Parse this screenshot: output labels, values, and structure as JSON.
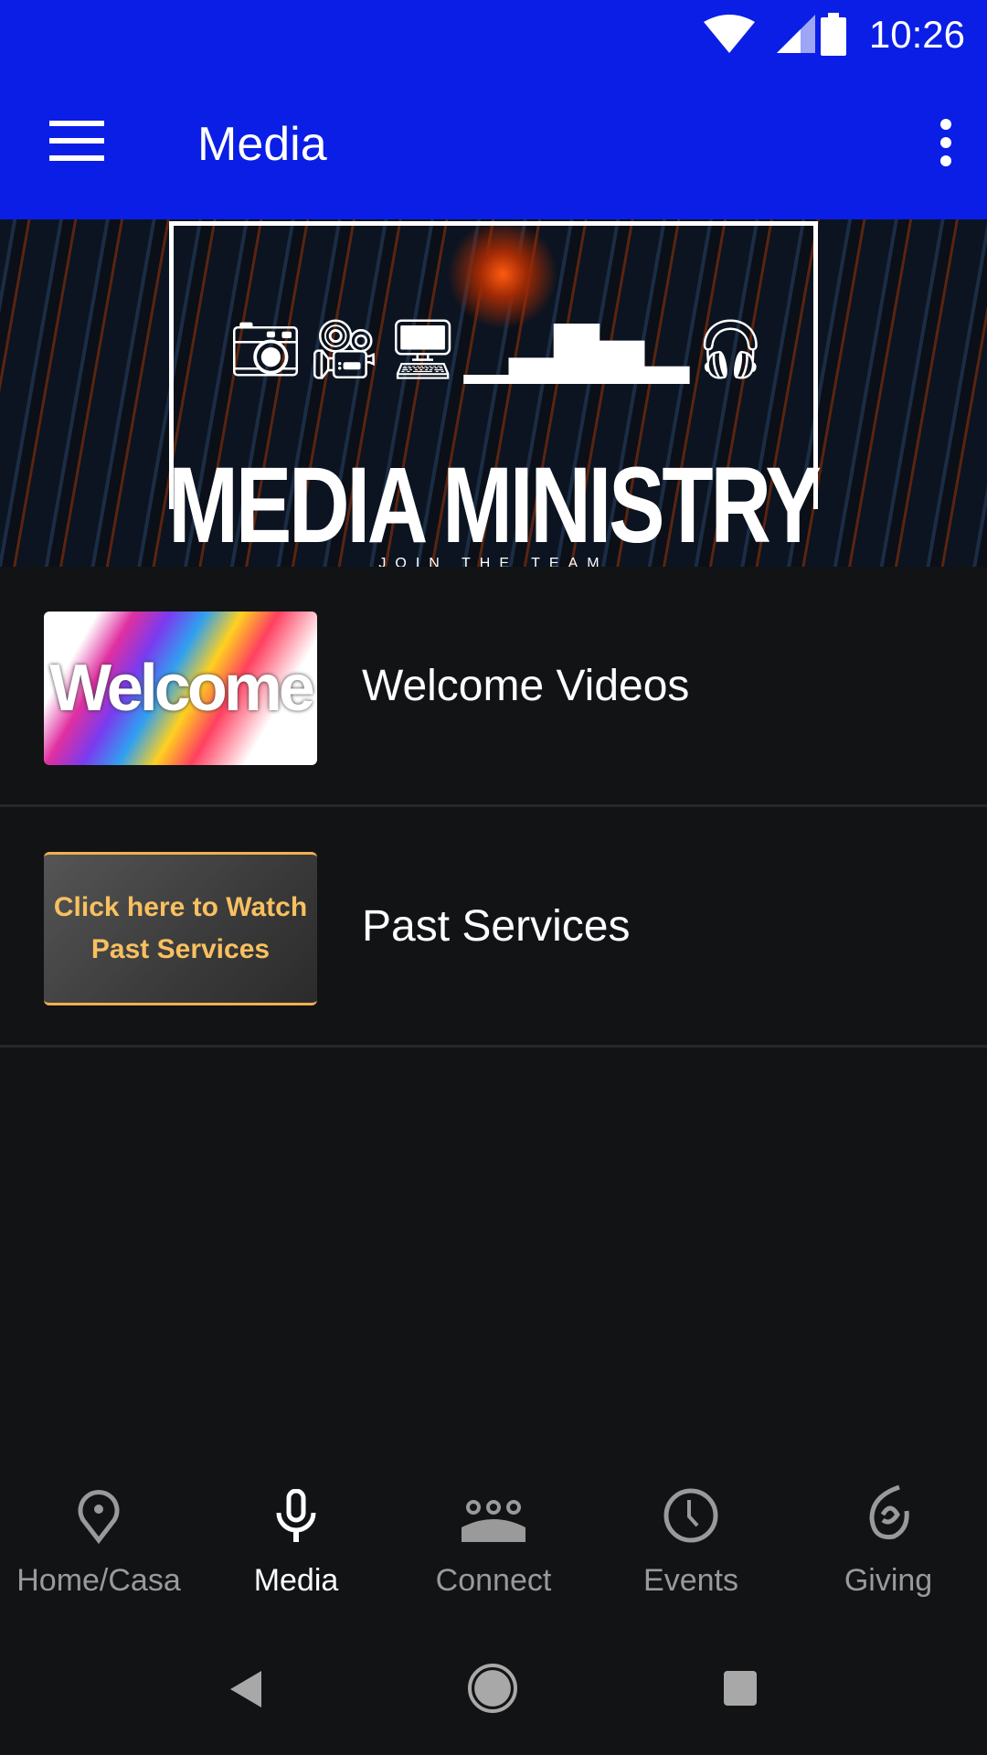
{
  "status_bar": {
    "time": "10:26",
    "icons": [
      "wifi-icon",
      "signal-icon",
      "battery-icon"
    ]
  },
  "app_bar": {
    "title": "Media",
    "menu_icon": "hamburger-icon",
    "more_icon": "more-vert-icon"
  },
  "banner": {
    "headline": "MEDIA MINISTRY",
    "subtext": "JOIN THE TEAM",
    "icons": [
      "camera-icon",
      "video-camera-icon",
      "monitor-icon",
      "audio-bars-icon",
      "headphones-icon"
    ]
  },
  "list": [
    {
      "label": "Welcome Videos",
      "thumb_text": "Welcome"
    },
    {
      "label": "Past Services",
      "thumb_text_1": "Click here to Watch",
      "thumb_text_2": "Past Services"
    }
  ],
  "bottom_nav": [
    {
      "label": "Home/Casa",
      "icon": "location-pin-icon",
      "active": false
    },
    {
      "label": "Media",
      "icon": "microphone-icon",
      "active": true
    },
    {
      "label": "Connect",
      "icon": "group-icon",
      "active": false
    },
    {
      "label": "Events",
      "icon": "clock-icon",
      "active": false
    },
    {
      "label": "Giving",
      "icon": "giving-hand-icon",
      "active": false
    }
  ],
  "colors": {
    "primary": "#0a1ee6",
    "background": "#121315",
    "inactive": "#9a9a9a",
    "accent_thumb": "#f8c060"
  }
}
